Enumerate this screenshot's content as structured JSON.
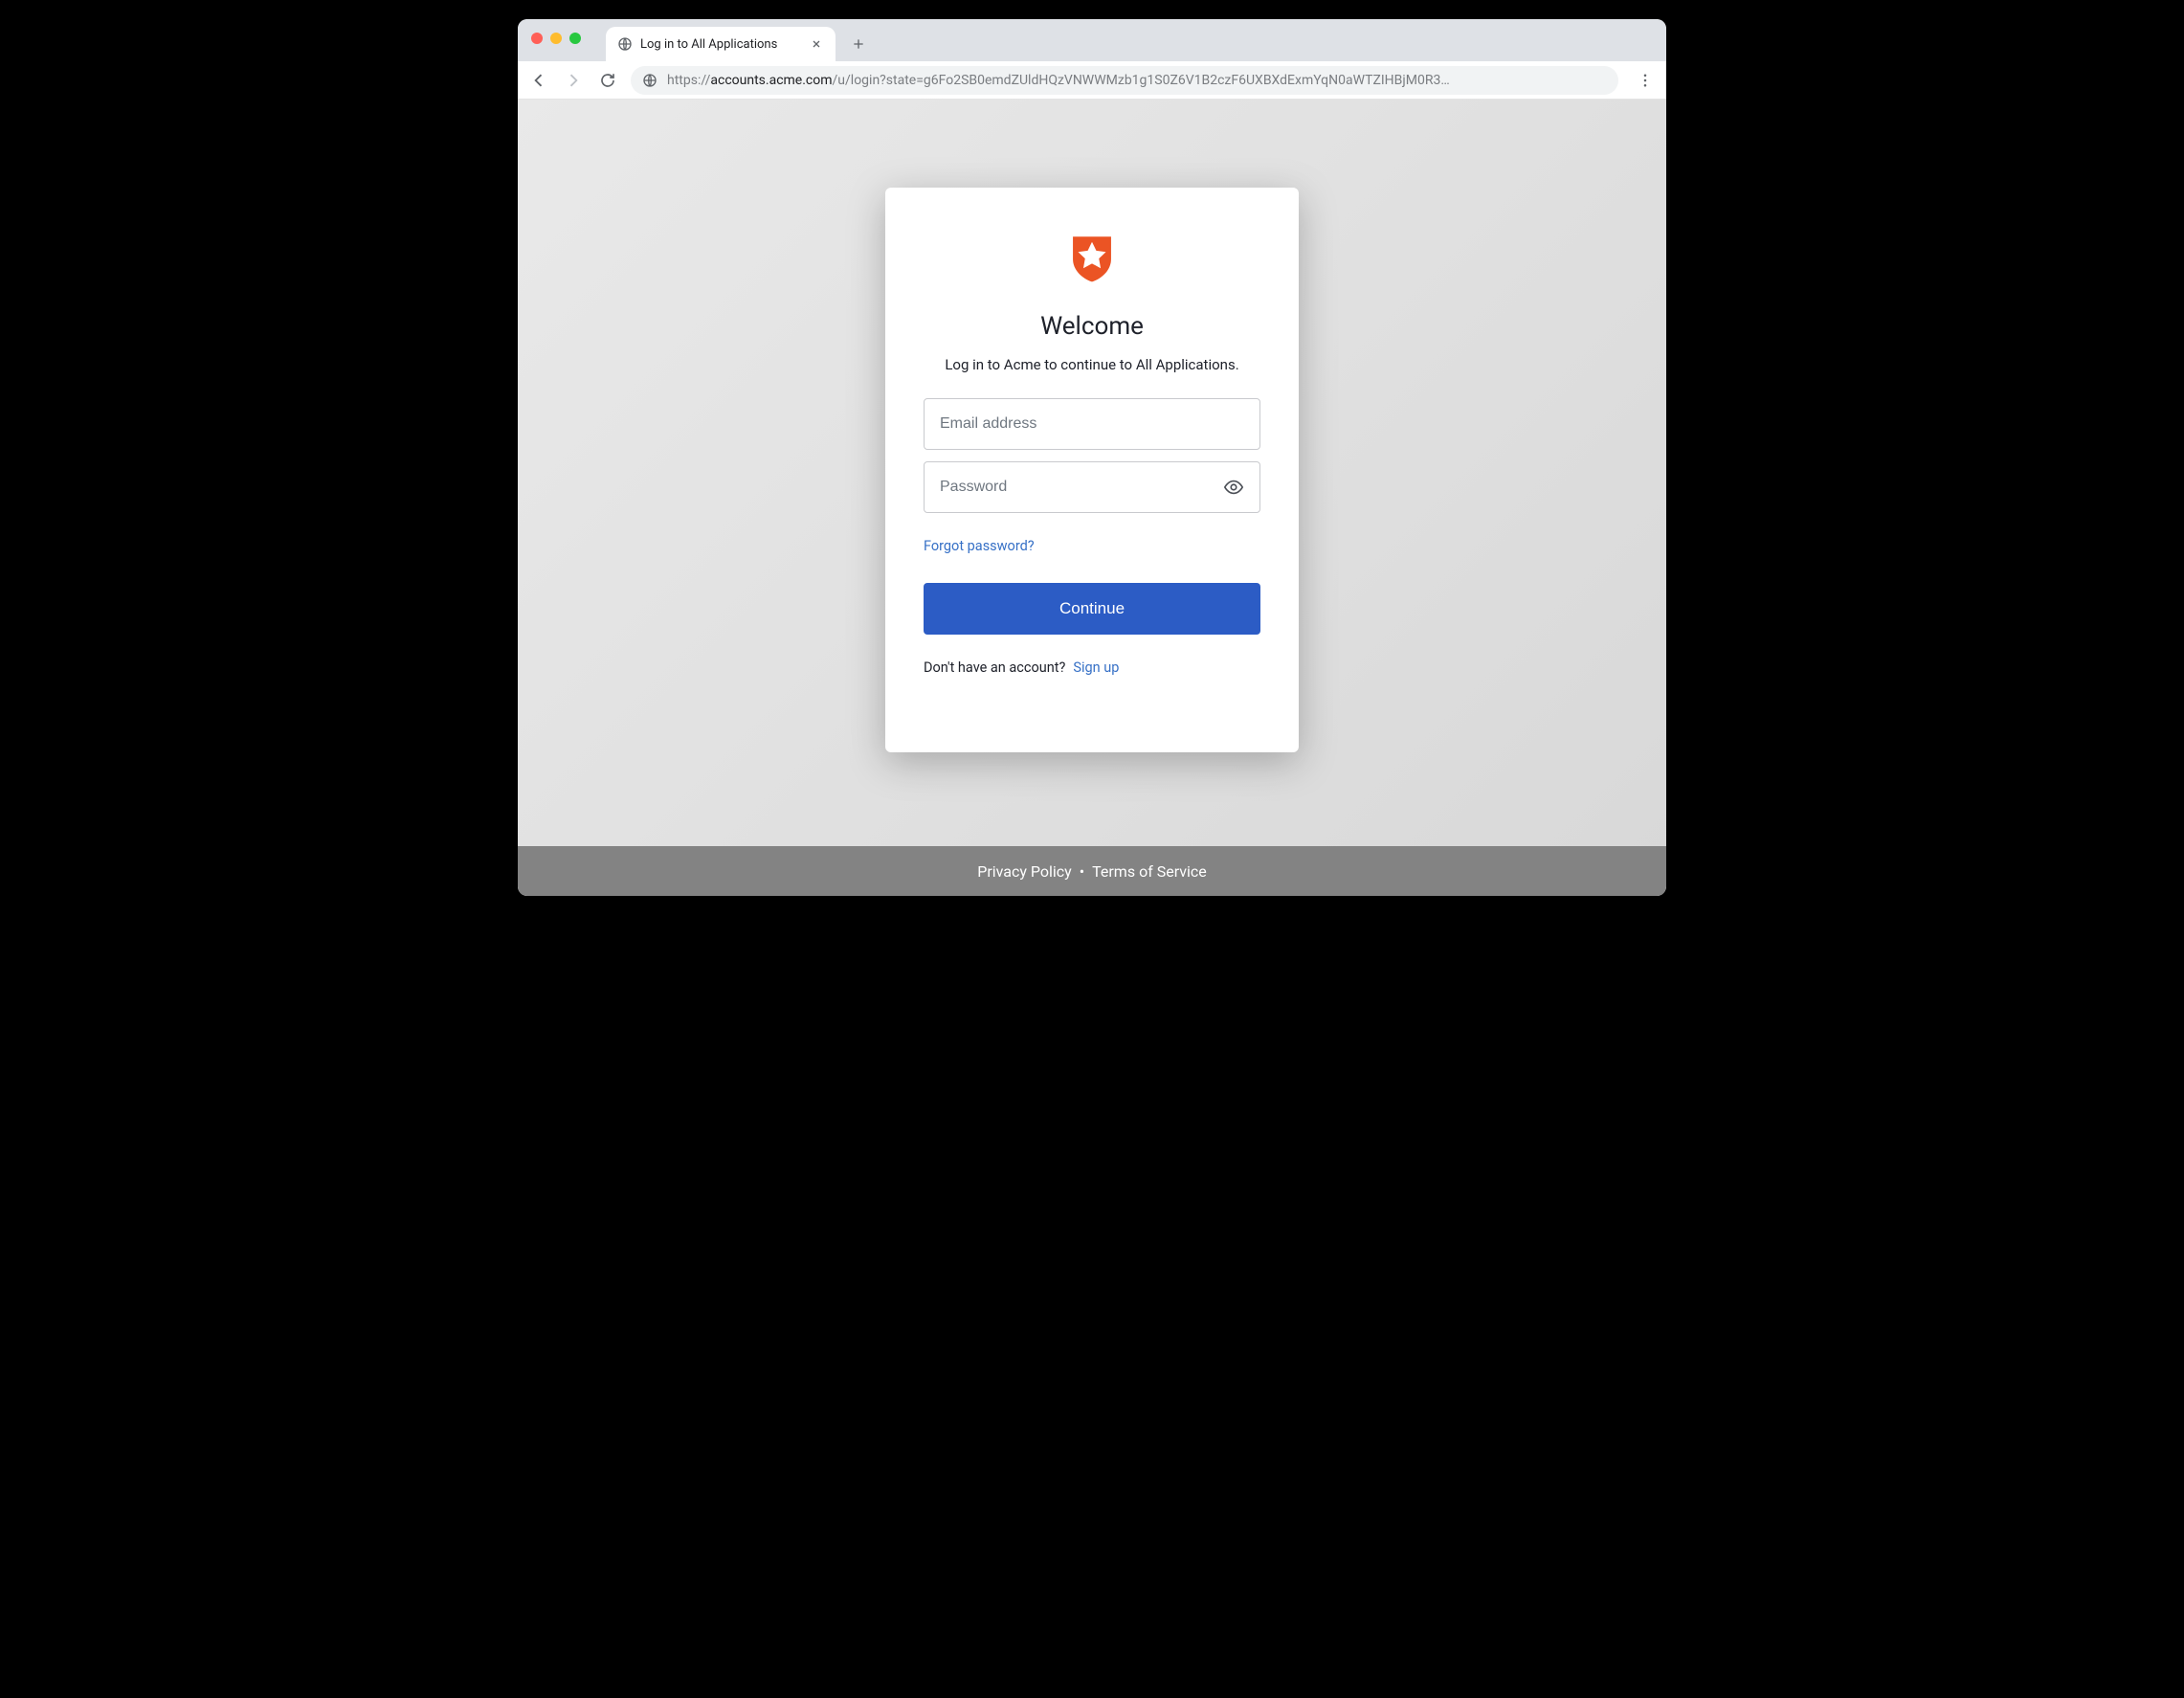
{
  "browser": {
    "tab": {
      "title": "Log in to All Applications"
    },
    "url_prefix": "https://",
    "url_host": "accounts.acme.com",
    "url_path": "/u/login?state=g6Fo2SB0emdZUldHQzVNWWMzb1g1S0Z6V1B2czF6UXBXdExmYqN0aWTZIHBjM0R3…"
  },
  "login": {
    "welcome": "Welcome",
    "subtitle": "Log in to Acme to continue to All Applications.",
    "email_placeholder": "Email address",
    "password_placeholder": "Password",
    "forgot": "Forgot password?",
    "continue": "Continue",
    "no_account": "Don't have an account?",
    "signup": "Sign up"
  },
  "footer": {
    "privacy": "Privacy Policy",
    "terms": "Terms of Service"
  },
  "colors": {
    "primary_button": "#2c5cc5",
    "link": "#3670c6",
    "logo": "#eb5424"
  }
}
